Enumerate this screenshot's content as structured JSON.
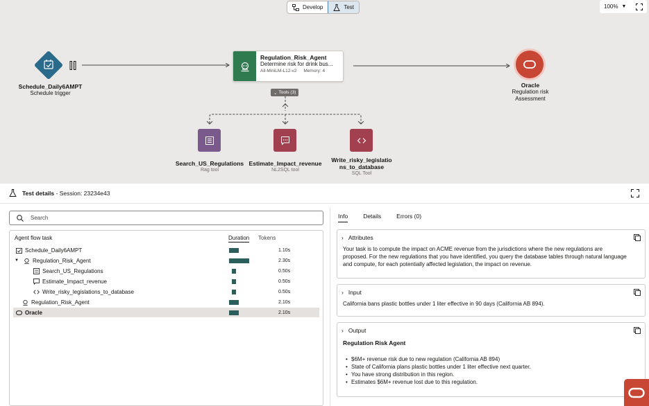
{
  "toolbar": {
    "develop_label": "Develop",
    "test_label": "Test",
    "zoom": "100%"
  },
  "flow": {
    "trigger": {
      "title": "Schedule_Daily6AMPT",
      "subtitle": "Schedule trigger"
    },
    "agent": {
      "title": "Regulation_Risk_Agent",
      "desc": "Determine risk for drink bus...",
      "model": "All-MiniLM-L12-v2",
      "memory": "Memory: 4",
      "tools_badge": "Tools (3)"
    },
    "tools": [
      {
        "title": "Search_US_Regulations",
        "subtitle": "Rag tool"
      },
      {
        "title": "Estimate_Impact_revenue",
        "subtitle": "NL2SQL tool"
      },
      {
        "title_line1": "Write_risky_legislatio",
        "title_line2": "ns_to_database",
        "subtitle": "SQL Tool"
      }
    ],
    "oracle": {
      "title": "Oracle",
      "subtitle_line1": "Regulation risk",
      "subtitle_line2": "Assessment"
    }
  },
  "details": {
    "title": "Test details",
    "session": "Session: 23234e43",
    "search_placeholder": "Search",
    "tree": {
      "col_task": "Agent flow task",
      "col_duration": "Duration",
      "col_tokens": "Tokens",
      "rows": [
        {
          "name": "Schedule_Daily6AMPT",
          "duration": "1.10s"
        },
        {
          "name": "Regulation_Risk_Agent",
          "duration": "2.30s"
        },
        {
          "name": "Search_US_Regulations",
          "duration": "0.50s"
        },
        {
          "name": "Estimate_Impact_revenue",
          "duration": "0.50s"
        },
        {
          "name": "Write_risky_legislations_to_database",
          "duration": "0.50s"
        },
        {
          "name": "Regulation_Risk_Agent",
          "duration": "2.10s"
        },
        {
          "name": "Oracle",
          "duration": "2.10s"
        }
      ]
    },
    "tabs": {
      "info": "Info",
      "details": "Details",
      "errors": "Errors (0)"
    },
    "attributes": {
      "label": "Attributes",
      "line1": "Your task is to compute the impact on ACME revenue from the jurisdictions where the new regulations are",
      "line2": "proposed. For the new regulations that you have identified, you query the database tables through natural language",
      "line3": "and compute, for  each potentially affected legislation, the impact on revenue."
    },
    "input": {
      "label": "Input",
      "text": "California bans plastic bottles under 1 liter effective in 90 days (California AB 894)."
    },
    "output": {
      "label": "Output",
      "title": "Regulation Risk Agent",
      "items": [
        "$6M+ revenue risk due to new regulation (California AB 894)",
        "State of California plans plastic bottles under 1 liter effective next quarter.",
        "You have strong distribution in this region.",
        "Estimates $6M+ revenue lost due to this regulation."
      ]
    }
  },
  "colors": {
    "agent_green": "#2f7a4f",
    "tool_purple": "#7a5a8c",
    "tool_red": "#a2404f",
    "oracle_red": "#c74634",
    "bar_teal": "#2c5e5c"
  }
}
